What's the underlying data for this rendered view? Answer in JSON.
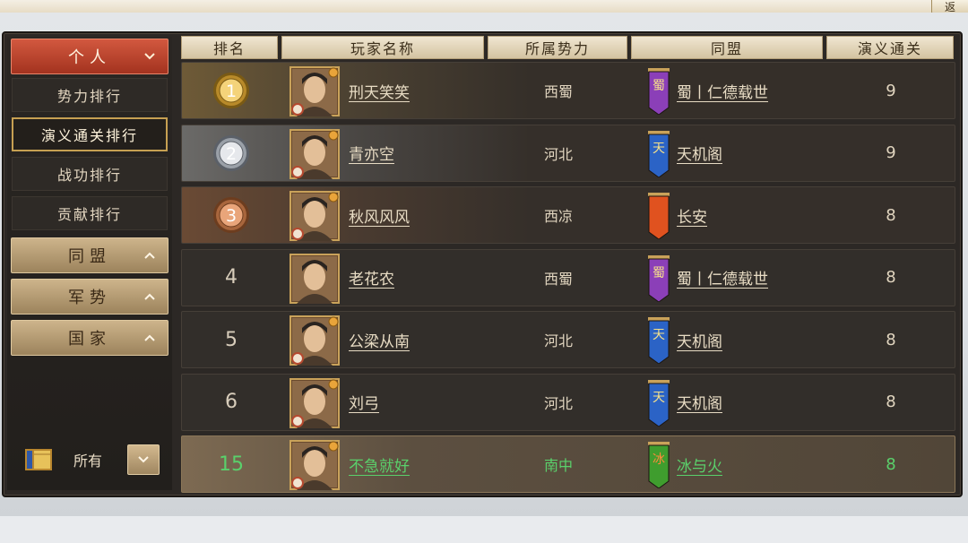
{
  "top_corner_label": "返",
  "sidebar": {
    "sections": [
      {
        "label": "个人",
        "state": "expanded"
      },
      {
        "label": "同盟",
        "state": "collapsed"
      },
      {
        "label": "军势",
        "state": "collapsed"
      },
      {
        "label": "国家",
        "state": "collapsed"
      }
    ],
    "items": [
      {
        "label": "势力排行"
      },
      {
        "label": "演义通关排行"
      },
      {
        "label": "战功排行"
      },
      {
        "label": "贡献排行"
      }
    ],
    "selected_item": "演义通关排行",
    "filter": {
      "label": "所有"
    }
  },
  "table": {
    "headers": [
      "排名",
      "玩家名称",
      "所属势力",
      "同盟",
      "演义通关"
    ],
    "rows": [
      {
        "rank": "1",
        "medal": "gold",
        "name": "刑天笑笑",
        "faction": "西蜀",
        "banner_char": "蜀",
        "banner_color": "#8b3fb8",
        "alliance": "蜀丨仁德载世",
        "score": "9"
      },
      {
        "rank": "2",
        "medal": "silver",
        "name": "青亦空",
        "faction": "河北",
        "banner_char": "天",
        "banner_color": "#2b63c6",
        "alliance": "天机阁",
        "score": "9"
      },
      {
        "rank": "3",
        "medal": "bronze",
        "name": "秋风风风",
        "faction": "西凉",
        "banner_char": "",
        "banner_color": "#e0521f",
        "alliance": "长安",
        "score": "8"
      },
      {
        "rank": "4",
        "medal": "",
        "name": "老花农",
        "faction": "西蜀",
        "banner_char": "蜀",
        "banner_color": "#8b3fb8",
        "alliance": "蜀丨仁德载世",
        "score": "8"
      },
      {
        "rank": "5",
        "medal": "",
        "name": "公梁从南",
        "faction": "河北",
        "banner_char": "天",
        "banner_color": "#2b63c6",
        "alliance": "天机阁",
        "score": "8"
      },
      {
        "rank": "6",
        "medal": "",
        "name": "刘弓",
        "faction": "河北",
        "banner_char": "天",
        "banner_color": "#2b63c6",
        "alliance": "天机阁",
        "score": "8"
      },
      {
        "rank": "15",
        "medal": "",
        "name": "不急就好",
        "faction": "南中",
        "banner_char": "冰",
        "banner_color": "#3f9d2e",
        "alliance": "冰与火",
        "score": "8",
        "is_self": true
      }
    ]
  }
}
